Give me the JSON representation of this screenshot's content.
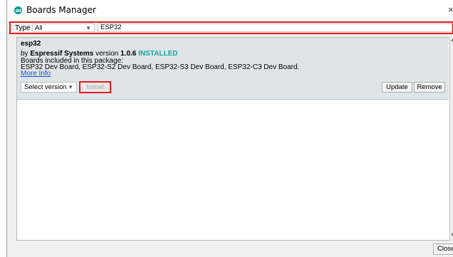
{
  "window": {
    "title": "Boards Manager",
    "close_glyph": "×"
  },
  "filter": {
    "type_label": "Type",
    "type_value": "All",
    "search_value": "ESP32"
  },
  "entry": {
    "name": "esp32",
    "by_prefix": "by",
    "author": "Espressif Systems",
    "version_prefix": "version",
    "version": "1.0.6",
    "status": "INSTALLED",
    "boards_label": "Boards included in this package:",
    "boards": "ESP32 Dev Board, ESP32-S2 Dev Board, ESP32-S3 Dev Board, ESP32-C3 Dev Board.",
    "more_info": "More Info",
    "select_version": "Select version",
    "install": "Install",
    "update": "Update",
    "remove": "Remove"
  },
  "footer": {
    "close": "Close"
  },
  "colors": {
    "highlight": "#e21b23",
    "installed": "#1aa5a7",
    "link": "#1a4fd6",
    "entry_bg": "#dfe4e7"
  }
}
